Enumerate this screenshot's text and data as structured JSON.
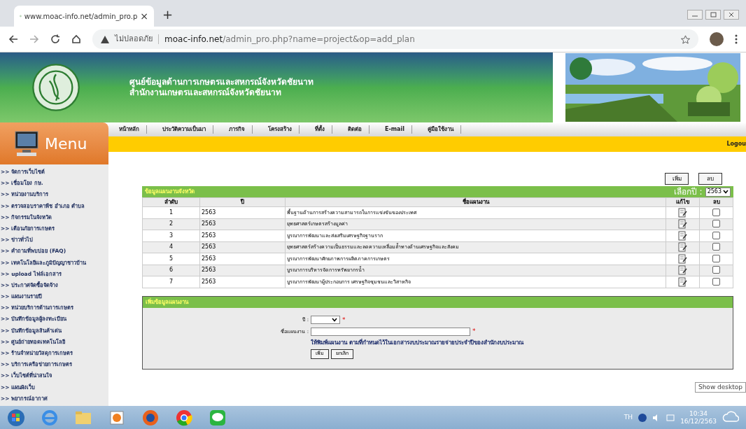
{
  "browser": {
    "tab_title": "www.moac-info.net/admin_pro.p",
    "close": "×",
    "new_tab": "+",
    "security": "ไม่ปลอดภัย",
    "url_host": "moac-info.net",
    "url_path": "/admin_pro.php?name=project&op=add_plan"
  },
  "header": {
    "title_lines": [
      "ศูนย์ข้อมูลด้านการเกษตรและสหกรณ์จังหวัดชัยนาท",
      "สำนักงานเกษตรและสหกรณ์จังหวัดชัยนาท"
    ],
    "menu_label": "Menu",
    "logout": "Logou"
  },
  "nav": [
    {
      "label": "หน้าหลัก"
    },
    {
      "label": "ประวัติความเป็นมา"
    },
    {
      "label": "ภารกิจ"
    },
    {
      "label": "โครงสร้าง"
    },
    {
      "label": "ที่ตั้ง"
    },
    {
      "label": "ติดต่อ"
    },
    {
      "label": "E-mail"
    },
    {
      "label": "คู่มือใช้งาน"
    }
  ],
  "sidebar": {
    "items": [
      {
        "label": ">> จัดการเว็บไซต์"
      },
      {
        "label": ">> เชื่อมโยง กษ."
      },
      {
        "label": ">> หน่วยงานบริการ"
      },
      {
        "label": ">> ตรวจสอบราคาพืช อำเภอ ตำบล"
      },
      {
        "label": ">> กิจกรรมในจังหวัด"
      },
      {
        "label": ">> เตือนภัยการเกษตร"
      },
      {
        "label": ">> ข่าวทั่วไป"
      },
      {
        "label": ">> คำถามที่พบบ่อย (FAQ)"
      },
      {
        "label": ">> เทคโนโลยีและภูมิปัญญาชาวบ้าน"
      },
      {
        "label": ">> upload ไฟล์เอกสาร"
      },
      {
        "label": ">> ประกาศจัดซื้อจัดจ้าง"
      },
      {
        "label": ">> แผนงานรายปี"
      },
      {
        "label": ">> หน่วยบริการด้านการเกษตร"
      },
      {
        "label": ">> บันทึกข้อมูลผู้ลงทะเบียน"
      },
      {
        "label": ">> บันทึกข้อมูลสินค้าเด่น"
      },
      {
        "label": ">> ศูนย์ถ่ายทอดเทคโนโลยี"
      },
      {
        "label": ">> ร้านจำหน่ายวัสดุการเกษตร"
      },
      {
        "label": ">> บริการเครือข่ายการเกษตร"
      },
      {
        "label": ">> เว็บไซต์ที่น่าสนใจ"
      },
      {
        "label": ">> แผนผังเว็บ"
      },
      {
        "label": ">> พยากรณ์อากาศ"
      }
    ]
  },
  "plans": {
    "top_buttons": [
      "เพิ่ม",
      "ลบ"
    ],
    "title": "ข้อมูลแผนงานจังหวัด",
    "year_label": "เลือกปี :",
    "year_value": "2563",
    "columns": [
      "ลำดับ",
      "ปี",
      "ชื่อแผนงาน",
      "แก้ไข",
      "ลบ"
    ],
    "rows": [
      {
        "no": "1",
        "year": "2563",
        "name": "พื้นฐานด้านการสร้างความสามารถในการแข่งขันของประเทศ",
        "checked": false
      },
      {
        "no": "2",
        "year": "2563",
        "name": "ยุทธศาสตร์เกษตรสร้างมูลค่า",
        "checked": false
      },
      {
        "no": "3",
        "year": "2563",
        "name": "บูรณาการพัฒนาและส่งเสริมเศรษฐกิจฐานราก",
        "checked": false
      },
      {
        "no": "4",
        "year": "2563",
        "name": "ยุทธศาสตร์สร้างความเป็นธรรมและลดความเหลื่อมล้ำทางด้านเศรษฐกิจและสังคม",
        "checked": false
      },
      {
        "no": "5",
        "year": "2563",
        "name": "บูรณาการพัฒนาศักยภาพการผลิตภาคการเกษตร",
        "checked": false
      },
      {
        "no": "6",
        "year": "2563",
        "name": "บูรณาการบริหารจัดการทรัพยากรน้ำ",
        "checked": false
      },
      {
        "no": "7",
        "year": "2563",
        "name": "บูรณาการพัฒนาผู้ประกอบการ เศรษฐกิจชุมชนและวิสาหกิจ",
        "checked": false
      }
    ]
  },
  "form": {
    "title": "เพิ่มข้อมูลแผนงาน",
    "fields": [
      {
        "kind": "select",
        "label": "ปี :",
        "required": "*"
      },
      {
        "kind": "text",
        "label": "ชื่อแผนงาน :",
        "required": "*"
      }
    ],
    "hint": "ให้พิมพ์แผนงาน ตามที่กำหนดไว้ในเอกสารงบประมาณรายจ่ายประจำปีของสำนักงบประมาณ",
    "buttons": [
      "เพิ่ม",
      "ยกเลิก"
    ]
  },
  "taskbar": {
    "tooltip": "Show desktop",
    "language": "TH",
    "time": "10:34",
    "date": "16/12/2563"
  }
}
